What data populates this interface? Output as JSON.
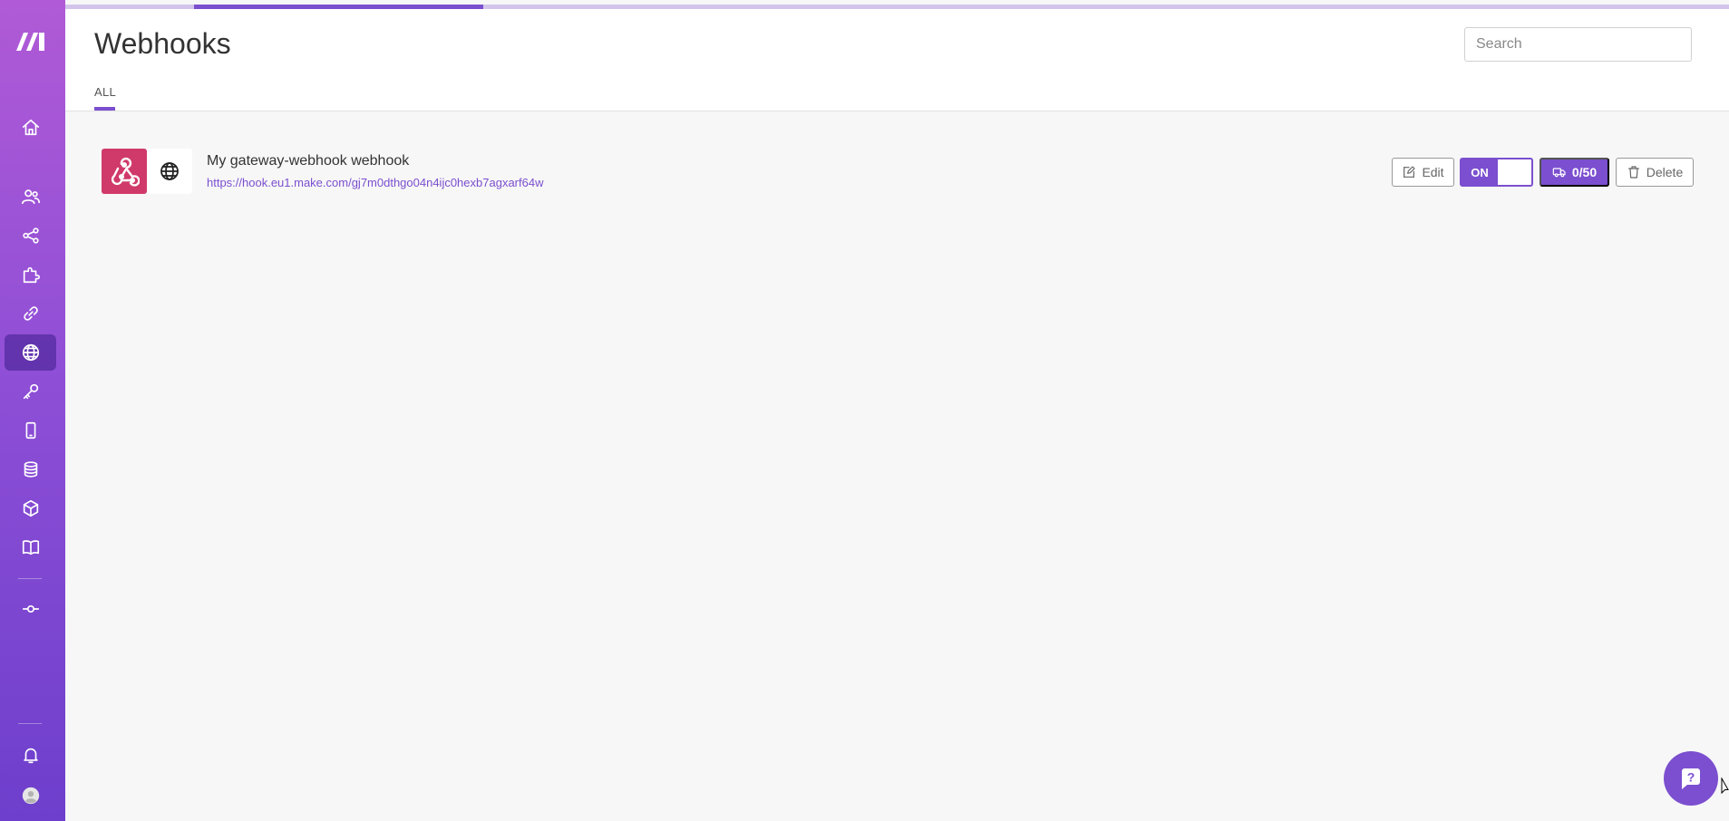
{
  "page": {
    "title": "Webhooks"
  },
  "search": {
    "placeholder": "Search",
    "value": ""
  },
  "tabs": [
    {
      "label": "ALL",
      "active": true
    }
  ],
  "progress": {
    "fraction": 0.17
  },
  "sidebar": {
    "items": [
      {
        "name": "home",
        "icon": "home-icon"
      },
      {
        "name": "teams",
        "icon": "users-icon"
      },
      {
        "name": "scenarios",
        "icon": "share-icon"
      },
      {
        "name": "templates",
        "icon": "puzzle-icon"
      },
      {
        "name": "connections",
        "icon": "link-icon"
      },
      {
        "name": "webhooks",
        "icon": "globe-icon",
        "active": true
      },
      {
        "name": "keys",
        "icon": "key-icon"
      },
      {
        "name": "devices",
        "icon": "mobile-icon"
      },
      {
        "name": "data-stores",
        "icon": "database-icon"
      },
      {
        "name": "data-structures",
        "icon": "cube-icon"
      },
      {
        "name": "docs",
        "icon": "book-icon"
      },
      {
        "name": "version",
        "icon": "commit-icon"
      },
      {
        "name": "notifications",
        "icon": "bell-icon"
      },
      {
        "name": "profile",
        "icon": "avatar-icon"
      }
    ]
  },
  "webhooks": [
    {
      "name": "My gateway-webhook webhook",
      "url": "https://hook.eu1.make.com/gj7m0dthgo04n4ijc0hexb7agxarf64w",
      "edit_label": "Edit",
      "toggle_label": "ON",
      "toggle_state": true,
      "queue_label": "0/50",
      "delete_label": "Delete"
    }
  ],
  "colors": {
    "accent": "#7b4fcf",
    "webhook_icon_bg": "#d03a6a"
  }
}
